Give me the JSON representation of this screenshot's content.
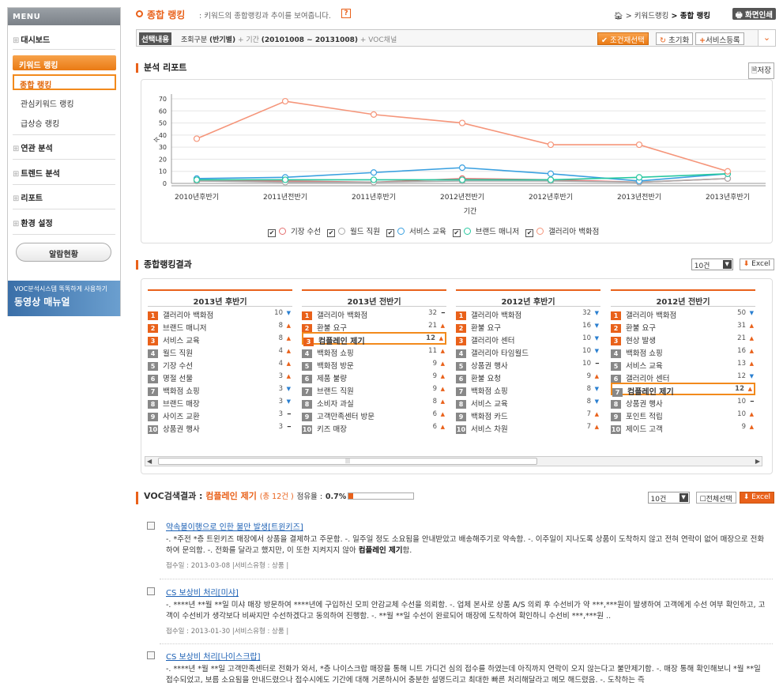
{
  "sidebar": {
    "header": "MENU",
    "items": {
      "dashboard": "대시보드",
      "keyword_ranking": "키워드 랭킹",
      "overall_ranking": "종합 랭킹",
      "interest_ranking": "관심키워드 랭킹",
      "rising_ranking": "급상승 랭킹",
      "related_analysis": "연관 분석",
      "trend_analysis": "트렌드 분석",
      "report": "리포트",
      "settings": "환경 설정"
    },
    "alarm_button": "알람현황",
    "banner": {
      "small": "VOC분석시스템 똑똑하게 사용하기",
      "big": "동영상 매뉴얼"
    }
  },
  "header": {
    "title": "종합 랭킹",
    "desc": ": 키워드의 종합랭킹과 추이를 보여줍니다.",
    "help": "?",
    "breadcrumb": {
      "mid": "> 키워드랭킹",
      "cur": "> 종합 랭킹"
    },
    "print": "화면인쇄"
  },
  "filter": {
    "label": "선택내용",
    "period_type_label": "조회구분",
    "period_type": "(반기별)",
    "range_label": "+ 기간",
    "range": "(20101008 ~ 20131008)",
    "channel": "+ VOC채널",
    "btn_reselect": "조건재선택",
    "btn_reset": "초기화",
    "btn_add": "서비스등록"
  },
  "analysis": {
    "title": "분석 리포트",
    "save": "저장"
  },
  "chart_data": {
    "type": "line",
    "x": [
      "2010년후반기",
      "2011년전반기",
      "2011년후반기",
      "2012년전반기",
      "2012년후반기",
      "2013년전반기",
      "2013년후반기"
    ],
    "xlabel": "기간",
    "ylabel": "수",
    "ylim": [
      0,
      70
    ],
    "yticks": [
      0,
      10,
      20,
      30,
      40,
      50,
      60,
      70
    ],
    "series": [
      {
        "name": "기장 수선",
        "color": "#e47070",
        "values": [
          2,
          2,
          1,
          4,
          3,
          1,
          4
        ]
      },
      {
        "name": "월드 직원",
        "color": "#aaaaaa",
        "values": [
          2,
          1,
          1,
          2,
          2,
          1,
          4
        ]
      },
      {
        "name": "서비스 교육",
        "color": "#3aa0e0",
        "values": [
          4,
          5,
          9,
          13,
          8,
          2,
          8
        ]
      },
      {
        "name": "브랜드 매니저",
        "color": "#28c8a0",
        "values": [
          3,
          3,
          3,
          3,
          3,
          5,
          8
        ]
      },
      {
        "name": "갤러리아 백화점",
        "color": "#f5957a",
        "values": [
          37,
          68,
          57,
          50,
          32,
          32,
          10
        ]
      }
    ]
  },
  "ranking": {
    "title": "종합랭킹결과",
    "page_size": "10건",
    "excel": "Excel",
    "columns": [
      {
        "period": "2013년 후반기",
        "items": [
          {
            "rank": "1",
            "name": "갤러리아 백화점",
            "value": "10",
            "trend": "down"
          },
          {
            "rank": "2",
            "name": "브랜드 매니저",
            "value": "8",
            "trend": "up"
          },
          {
            "rank": "3",
            "name": "서비스 교육",
            "value": "8",
            "trend": "up"
          },
          {
            "rank": "4",
            "name": "월드 직원",
            "value": "4",
            "trend": "up"
          },
          {
            "rank": "5",
            "name": "기장 수선",
            "value": "4",
            "trend": "up"
          },
          {
            "rank": "6",
            "name": "명절 선물",
            "value": "3",
            "trend": "up"
          },
          {
            "rank": "7",
            "name": "백화점 쇼핑",
            "value": "3",
            "trend": "down"
          },
          {
            "rank": "8",
            "name": "브랜드 매장",
            "value": "3",
            "trend": "down"
          },
          {
            "rank": "9",
            "name": "사이즈 교환",
            "value": "3",
            "trend": "same"
          },
          {
            "rank": "10",
            "name": "상품권 행사",
            "value": "3",
            "trend": "same"
          }
        ]
      },
      {
        "period": "2013년 전반기",
        "items": [
          {
            "rank": "1",
            "name": "갤러리아 백화점",
            "value": "32",
            "trend": "same"
          },
          {
            "rank": "2",
            "name": "환불 요구",
            "value": "21",
            "trend": "up"
          },
          {
            "rank": "3",
            "name": "컴플레인 제기",
            "value": "12",
            "trend": "up",
            "highlight": true
          },
          {
            "rank": "4",
            "name": "백화점 쇼핑",
            "value": "11",
            "trend": "up"
          },
          {
            "rank": "5",
            "name": "백화점 방문",
            "value": "9",
            "trend": "up"
          },
          {
            "rank": "6",
            "name": "제품 불량",
            "value": "9",
            "trend": "up"
          },
          {
            "rank": "7",
            "name": "브랜드 직원",
            "value": "9",
            "trend": "up"
          },
          {
            "rank": "8",
            "name": "소비자 과실",
            "value": "8",
            "trend": "up"
          },
          {
            "rank": "9",
            "name": "고객만족센터 방문",
            "value": "6",
            "trend": "up"
          },
          {
            "rank": "10",
            "name": "키즈 매장",
            "value": "6",
            "trend": "up"
          }
        ]
      },
      {
        "period": "2012년 후반기",
        "items": [
          {
            "rank": "1",
            "name": "갤러리아 백화점",
            "value": "32",
            "trend": "down"
          },
          {
            "rank": "2",
            "name": "환불 요구",
            "value": "16",
            "trend": "down"
          },
          {
            "rank": "3",
            "name": "갤러리아 센터",
            "value": "10",
            "trend": "down"
          },
          {
            "rank": "4",
            "name": "갤러리아 타임월드",
            "value": "10",
            "trend": "down"
          },
          {
            "rank": "5",
            "name": "상품권 행사",
            "value": "10",
            "trend": "same"
          },
          {
            "rank": "6",
            "name": "환불 요청",
            "value": "9",
            "trend": "up"
          },
          {
            "rank": "7",
            "name": "백화점 쇼핑",
            "value": "8",
            "trend": "down"
          },
          {
            "rank": "8",
            "name": "서비스 교육",
            "value": "8",
            "trend": "down"
          },
          {
            "rank": "9",
            "name": "백화점 카드",
            "value": "7",
            "trend": "up"
          },
          {
            "rank": "10",
            "name": "서비스 차원",
            "value": "7",
            "trend": "up"
          }
        ]
      },
      {
        "period": "2012년 전반기",
        "items": [
          {
            "rank": "1",
            "name": "갤러리아 백화점",
            "value": "50",
            "trend": "down"
          },
          {
            "rank": "2",
            "name": "환불 요구",
            "value": "31",
            "trend": "up"
          },
          {
            "rank": "3",
            "name": "현상 발생",
            "value": "21",
            "trend": "up"
          },
          {
            "rank": "4",
            "name": "백화점 쇼핑",
            "value": "16",
            "trend": "up"
          },
          {
            "rank": "5",
            "name": "서비스 교육",
            "value": "13",
            "trend": "up"
          },
          {
            "rank": "6",
            "name": "갤러리아 센터",
            "value": "12",
            "trend": "down"
          },
          {
            "rank": "7",
            "name": "컴플레인 제기",
            "value": "12",
            "trend": "up",
            "highlight": true
          },
          {
            "rank": "8",
            "name": "상품권 행사",
            "value": "10",
            "trend": "same"
          },
          {
            "rank": "9",
            "name": "포인트 적립",
            "value": "10",
            "trend": "up"
          },
          {
            "rank": "10",
            "name": "제이드 고객",
            "value": "9",
            "trend": "up"
          }
        ]
      }
    ]
  },
  "voc": {
    "title_prefix": "VOC검색결과 :",
    "keyword": "컴플레인 제기",
    "count": "(총 12건 )",
    "share_label": "점유율 :",
    "share_value": "0.7%",
    "share_fraction": 0.07,
    "page_size": "10건",
    "select_all": "전체선택",
    "excel": "Excel",
    "items": [
      {
        "title": "약속불이행으로 인한 불만 발생[트윈키즈]",
        "body": "-. *주전 *층 트윈키즈 매장에서 상품을 결제하고 주문함. -. 일주일 정도 소요됨을 안내받았고 배송해주기로 약속함. -. 이주일이 지나도록 상품이 도착하지 않고 전혀 연락이 없어 매장으로 전화하여 문의함. -. 전화를 달라고 했지만, 이 또한 지켜지지 않아 ",
        "body_kw": "컴플레인 제기",
        "body_end": "함.",
        "meta": "접수일 : 2013-03-08  |서비스유형 : 상품  |"
      },
      {
        "title": "CS 보상비 처리[미샤]",
        "body": "-. ****년 **월 **일 미샤 매장 방문하여 ****년에 구입하신 모피 안감교체 수선을 의뢰함. -. 업체 본사로 상품 A/S 의뢰 후 수선비가 약 ***,***원이 발생하여 고객에게 수선 여부 확인하고, 고객이 수선비가 생각보다 비싸지만 수선하겠다고 동의하여 진행함. -. **월 **일 수선이 완료되어 매장에 도착하여 확인하니 수선비 ***,***원 ..",
        "meta": "접수일 : 2013-01-30  |서비스유형 : 상품  |"
      },
      {
        "title": "CS 보상비 처리[나이스크랍]",
        "body": "-. ****년 *월 **일 고객만족센터로 전화가 와서, *층 나이스크랍 매장을 통해 니트 가디건 심의 접수를 하였는데 아직까지 연락이 오지 않는다고 불만제기함. -. 매장 통해 확인해보니 *월 **일 접수되었고, 보름 소요됨을 안내드렸으나 접수시에도 기간에 대해 거론하시어 충분한 설명드리고 최대한 빠른 처리해달라고 메모 해드렸음. -. 도착하는 즉"
      }
    ]
  }
}
